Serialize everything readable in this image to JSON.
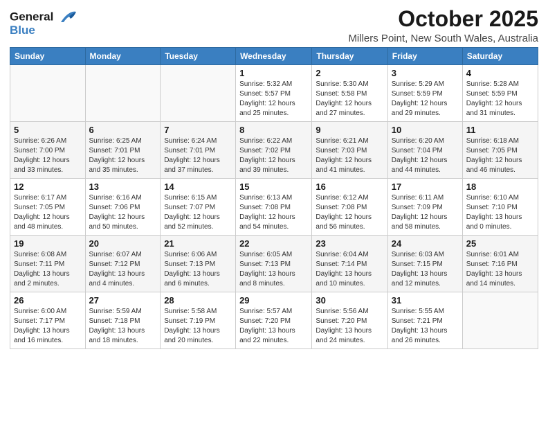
{
  "header": {
    "logo_line1": "General",
    "logo_line2": "Blue",
    "month": "October 2025",
    "location": "Millers Point, New South Wales, Australia"
  },
  "weekdays": [
    "Sunday",
    "Monday",
    "Tuesday",
    "Wednesday",
    "Thursday",
    "Friday",
    "Saturday"
  ],
  "weeks": [
    [
      {
        "day": "",
        "detail": ""
      },
      {
        "day": "",
        "detail": ""
      },
      {
        "day": "",
        "detail": ""
      },
      {
        "day": "1",
        "detail": "Sunrise: 5:32 AM\nSunset: 5:57 PM\nDaylight: 12 hours\nand 25 minutes."
      },
      {
        "day": "2",
        "detail": "Sunrise: 5:30 AM\nSunset: 5:58 PM\nDaylight: 12 hours\nand 27 minutes."
      },
      {
        "day": "3",
        "detail": "Sunrise: 5:29 AM\nSunset: 5:59 PM\nDaylight: 12 hours\nand 29 minutes."
      },
      {
        "day": "4",
        "detail": "Sunrise: 5:28 AM\nSunset: 5:59 PM\nDaylight: 12 hours\nand 31 minutes."
      }
    ],
    [
      {
        "day": "5",
        "detail": "Sunrise: 6:26 AM\nSunset: 7:00 PM\nDaylight: 12 hours\nand 33 minutes."
      },
      {
        "day": "6",
        "detail": "Sunrise: 6:25 AM\nSunset: 7:01 PM\nDaylight: 12 hours\nand 35 minutes."
      },
      {
        "day": "7",
        "detail": "Sunrise: 6:24 AM\nSunset: 7:01 PM\nDaylight: 12 hours\nand 37 minutes."
      },
      {
        "day": "8",
        "detail": "Sunrise: 6:22 AM\nSunset: 7:02 PM\nDaylight: 12 hours\nand 39 minutes."
      },
      {
        "day": "9",
        "detail": "Sunrise: 6:21 AM\nSunset: 7:03 PM\nDaylight: 12 hours\nand 41 minutes."
      },
      {
        "day": "10",
        "detail": "Sunrise: 6:20 AM\nSunset: 7:04 PM\nDaylight: 12 hours\nand 44 minutes."
      },
      {
        "day": "11",
        "detail": "Sunrise: 6:18 AM\nSunset: 7:05 PM\nDaylight: 12 hours\nand 46 minutes."
      }
    ],
    [
      {
        "day": "12",
        "detail": "Sunrise: 6:17 AM\nSunset: 7:05 PM\nDaylight: 12 hours\nand 48 minutes."
      },
      {
        "day": "13",
        "detail": "Sunrise: 6:16 AM\nSunset: 7:06 PM\nDaylight: 12 hours\nand 50 minutes."
      },
      {
        "day": "14",
        "detail": "Sunrise: 6:15 AM\nSunset: 7:07 PM\nDaylight: 12 hours\nand 52 minutes."
      },
      {
        "day": "15",
        "detail": "Sunrise: 6:13 AM\nSunset: 7:08 PM\nDaylight: 12 hours\nand 54 minutes."
      },
      {
        "day": "16",
        "detail": "Sunrise: 6:12 AM\nSunset: 7:08 PM\nDaylight: 12 hours\nand 56 minutes."
      },
      {
        "day": "17",
        "detail": "Sunrise: 6:11 AM\nSunset: 7:09 PM\nDaylight: 12 hours\nand 58 minutes."
      },
      {
        "day": "18",
        "detail": "Sunrise: 6:10 AM\nSunset: 7:10 PM\nDaylight: 13 hours\nand 0 minutes."
      }
    ],
    [
      {
        "day": "19",
        "detail": "Sunrise: 6:08 AM\nSunset: 7:11 PM\nDaylight: 13 hours\nand 2 minutes."
      },
      {
        "day": "20",
        "detail": "Sunrise: 6:07 AM\nSunset: 7:12 PM\nDaylight: 13 hours\nand 4 minutes."
      },
      {
        "day": "21",
        "detail": "Sunrise: 6:06 AM\nSunset: 7:13 PM\nDaylight: 13 hours\nand 6 minutes."
      },
      {
        "day": "22",
        "detail": "Sunrise: 6:05 AM\nSunset: 7:13 PM\nDaylight: 13 hours\nand 8 minutes."
      },
      {
        "day": "23",
        "detail": "Sunrise: 6:04 AM\nSunset: 7:14 PM\nDaylight: 13 hours\nand 10 minutes."
      },
      {
        "day": "24",
        "detail": "Sunrise: 6:03 AM\nSunset: 7:15 PM\nDaylight: 13 hours\nand 12 minutes."
      },
      {
        "day": "25",
        "detail": "Sunrise: 6:01 AM\nSunset: 7:16 PM\nDaylight: 13 hours\nand 14 minutes."
      }
    ],
    [
      {
        "day": "26",
        "detail": "Sunrise: 6:00 AM\nSunset: 7:17 PM\nDaylight: 13 hours\nand 16 minutes."
      },
      {
        "day": "27",
        "detail": "Sunrise: 5:59 AM\nSunset: 7:18 PM\nDaylight: 13 hours\nand 18 minutes."
      },
      {
        "day": "28",
        "detail": "Sunrise: 5:58 AM\nSunset: 7:19 PM\nDaylight: 13 hours\nand 20 minutes."
      },
      {
        "day": "29",
        "detail": "Sunrise: 5:57 AM\nSunset: 7:20 PM\nDaylight: 13 hours\nand 22 minutes."
      },
      {
        "day": "30",
        "detail": "Sunrise: 5:56 AM\nSunset: 7:20 PM\nDaylight: 13 hours\nand 24 minutes."
      },
      {
        "day": "31",
        "detail": "Sunrise: 5:55 AM\nSunset: 7:21 PM\nDaylight: 13 hours\nand 26 minutes."
      },
      {
        "day": "",
        "detail": ""
      }
    ]
  ]
}
